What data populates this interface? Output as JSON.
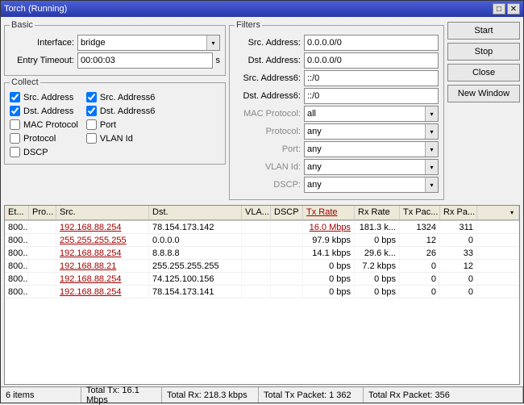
{
  "window": {
    "title": "Torch (Running)"
  },
  "buttons": {
    "start": "Start",
    "stop": "Stop",
    "close": "Close",
    "newwin": "New Window"
  },
  "basic": {
    "legend": "Basic",
    "interface_label": "Interface:",
    "interface_value": "bridge",
    "timeout_label": "Entry Timeout:",
    "timeout_value": "00:00:03",
    "timeout_unit": "s"
  },
  "collect": {
    "legend": "Collect",
    "src_addr": "Src. Address",
    "dst_addr": "Dst. Address",
    "mac_proto": "MAC Protocol",
    "proto": "Protocol",
    "dscp": "DSCP",
    "src_addr6": "Src. Address6",
    "dst_addr6": "Dst. Address6",
    "port": "Port",
    "vlan": "VLAN Id"
  },
  "filters": {
    "legend": "Filters",
    "src_addr_l": "Src. Address:",
    "src_addr_v": "0.0.0.0/0",
    "dst_addr_l": "Dst. Address:",
    "dst_addr_v": "0.0.0.0/0",
    "src_addr6_l": "Src. Address6:",
    "src_addr6_v": "::/0",
    "dst_addr6_l": "Dst. Address6:",
    "dst_addr6_v": "::/0",
    "mac_proto_l": "MAC Protocol:",
    "mac_proto_v": "all",
    "proto_l": "Protocol:",
    "proto_v": "any",
    "port_l": "Port:",
    "port_v": "any",
    "vlan_l": "VLAN Id:",
    "vlan_v": "any",
    "dscp_l": "DSCP:",
    "dscp_v": "any"
  },
  "columns": {
    "et": "Et...",
    "pro": "Pro...",
    "src": "Src.",
    "dst": "Dst.",
    "vla": "VLA...",
    "dscp": "DSCP",
    "tx": "Tx Rate",
    "rx": "Rx Rate",
    "txp": "Tx Pac...",
    "rxp": "Rx Pa..."
  },
  "rows": [
    {
      "et": "800...",
      "pro": "",
      "src": "192.168.88.254",
      "dst": "78.154.173.142",
      "vla": "",
      "dscp": "",
      "tx": "16.0 Mbps",
      "rx": "181.3 k...",
      "txp": "1324",
      "rxp": "311",
      "hl": true
    },
    {
      "et": "800...",
      "pro": "",
      "src": "255.255.255.255",
      "dst": "0.0.0.0",
      "vla": "",
      "dscp": "",
      "tx": "97.9 kbps",
      "rx": "0 bps",
      "txp": "12",
      "rxp": "0"
    },
    {
      "et": "800...",
      "pro": "",
      "src": "192.168.88.254",
      "dst": "8.8.8.8",
      "vla": "",
      "dscp": "",
      "tx": "14.1 kbps",
      "rx": "29.6 k...",
      "txp": "26",
      "rxp": "33"
    },
    {
      "et": "800...",
      "pro": "",
      "src": "192.168.88.21",
      "dst": "255.255.255.255",
      "vla": "",
      "dscp": "",
      "tx": "0 bps",
      "rx": "7.2 kbps",
      "txp": "0",
      "rxp": "12"
    },
    {
      "et": "800...",
      "pro": "",
      "src": "192.168.88.254",
      "dst": "74.125.100.156",
      "vla": "",
      "dscp": "",
      "tx": "0 bps",
      "rx": "0 bps",
      "txp": "0",
      "rxp": "0"
    },
    {
      "et": "800...",
      "pro": "",
      "src": "192.168.88.254",
      "dst": "78.154.173.141",
      "vla": "",
      "dscp": "",
      "tx": "0 bps",
      "rx": "0 bps",
      "txp": "0",
      "rxp": "0"
    }
  ],
  "status": {
    "items": "6 items",
    "totaltx": "Total Tx: 16.1 Mbps",
    "totalrx": "Total Rx: 218.3 kbps",
    "totaltxp": "Total Tx Packet: 1 362",
    "totalrxp": "Total Rx Packet: 356"
  }
}
